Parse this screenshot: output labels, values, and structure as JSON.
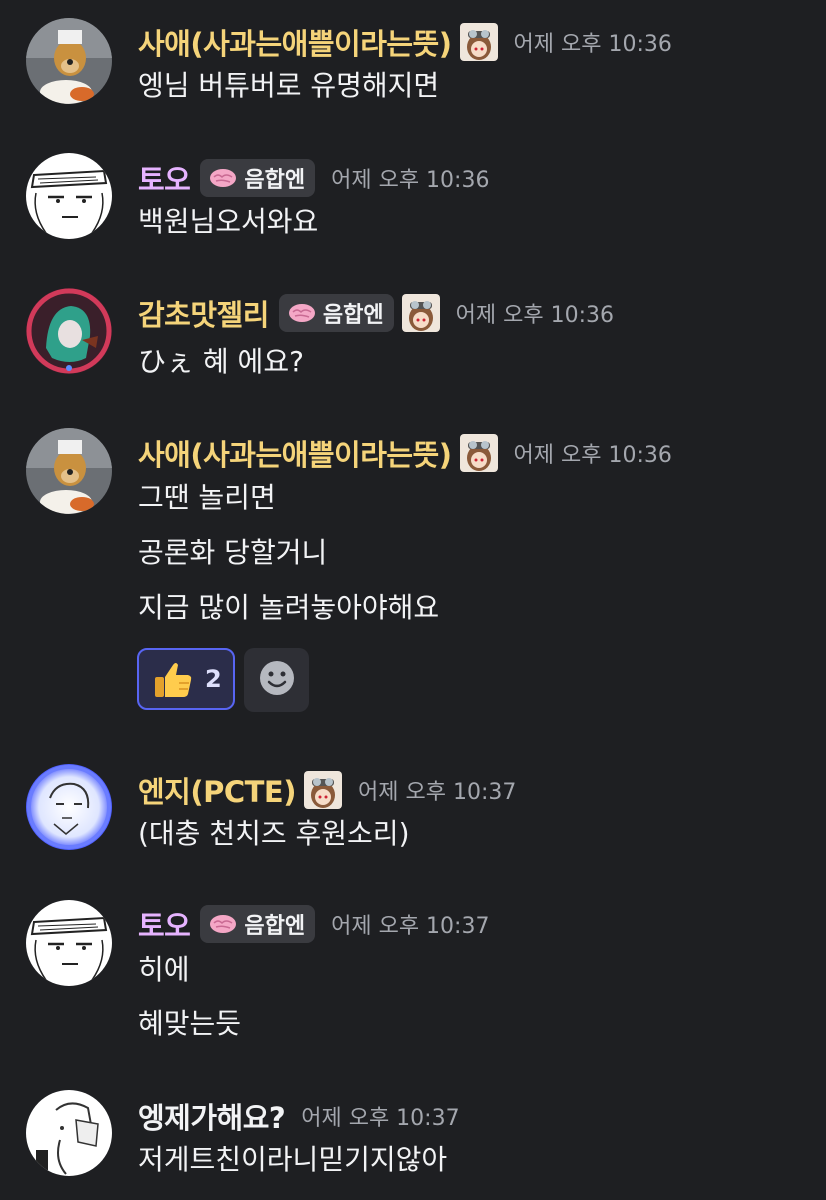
{
  "messages": [
    {
      "username": "사애(사과는애쁠이라는뜻)",
      "name_color": "#f5d47a",
      "role_icon": "anime-girl-goggles-icon",
      "tag": null,
      "timestamp": "어제 오후 10:36",
      "lines": [
        "엥님 버튜버로 유명해지면"
      ]
    },
    {
      "username": "토오",
      "name_color": "#e6b3ff",
      "tag": {
        "icon": "brain-icon",
        "label": "음합엔"
      },
      "timestamp": "어제 오후 10:36",
      "lines": [
        "백원님오서와요"
      ]
    },
    {
      "username": "감초맛젤리",
      "name_color": "#f5d47a",
      "tag": {
        "icon": "brain-icon",
        "label": "음합엔"
      },
      "role_icon": "anime-girl-goggles-icon",
      "timestamp": "어제 오후 10:36",
      "lines": [
        "ひぇ 혜 에요?"
      ]
    },
    {
      "username": "사애(사과는애쁠이라는뜻)",
      "name_color": "#f5d47a",
      "role_icon": "anime-girl-goggles-icon",
      "timestamp": "어제 오후 10:36",
      "lines": [
        "그땐 놀리면",
        "공론화 당할거니",
        "지금 많이 놀려놓아야해요"
      ],
      "reactions": [
        {
          "emoji": "thumbs-up-icon",
          "count": "2",
          "active": true
        }
      ],
      "add_reaction_icon": "smiley-add-reaction-icon"
    },
    {
      "username": "엔지(PCTE)",
      "name_color": "#f5d47a",
      "role_icon": "anime-girl-goggles-icon",
      "timestamp": "어제 오후 10:37",
      "lines": [
        "(대충 천치즈 후원소리)"
      ]
    },
    {
      "username": "토오",
      "name_color": "#e6b3ff",
      "tag": {
        "icon": "brain-icon",
        "label": "음합엔"
      },
      "timestamp": "어제 오후 10:37",
      "lines": [
        "히에",
        "혜맞는듯"
      ]
    },
    {
      "username": "엥제가해요?",
      "name_color": "#f2f3f5",
      "timestamp": "어제 오후 10:37",
      "lines": [
        "저게트친이라니믿기지않아"
      ]
    }
  ],
  "colors": {
    "background": "#1e1f22",
    "timestamp": "#a4a7ae",
    "reaction_active_border": "#5865f2"
  }
}
